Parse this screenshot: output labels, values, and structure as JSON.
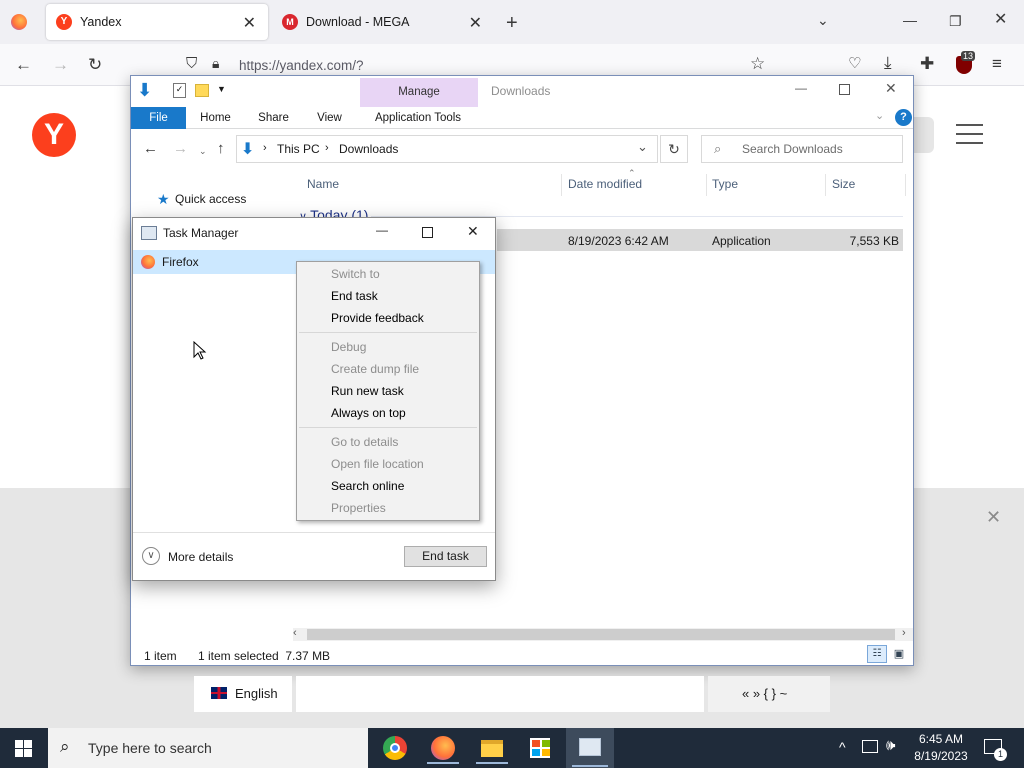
{
  "firefox": {
    "tabs": [
      {
        "title": "Yandex",
        "favicon": "yandex-favicon",
        "active": true
      },
      {
        "title": "Download - MEGA",
        "favicon": "mega-favicon",
        "active": false
      }
    ],
    "url": "https://yandex.com/?",
    "extension_badge": "13"
  },
  "explorer": {
    "title": "Downloads",
    "manage_label": "Manage",
    "ribbon_tabs": [
      "File",
      "Home",
      "Share",
      "View",
      "Application Tools"
    ],
    "breadcrumb": [
      "This PC",
      "Downloads"
    ],
    "search_placeholder": "Search Downloads",
    "sidebar": {
      "quick_access": "Quick access"
    },
    "columns": {
      "name": "Name",
      "date": "Date modified",
      "type": "Type",
      "size": "Size"
    },
    "group_header": "Today (1)",
    "file_row": {
      "date": "8/19/2023 6:42 AM",
      "type": "Application",
      "size": "7,553 KB"
    },
    "status": {
      "items": "1 item",
      "selected": "1 item selected  7.37 MB"
    }
  },
  "task_manager": {
    "title": "Task Manager",
    "process": "Firefox",
    "more_details": "More details",
    "end_task": "End task"
  },
  "context_menu": {
    "switch_to": "Switch to",
    "end_task": "End task",
    "provide_feedback": "Provide feedback",
    "debug": "Debug",
    "create_dump": "Create dump file",
    "run_new_task": "Run new task",
    "always_on_top": "Always on top",
    "go_to_details": "Go to details",
    "open_file_location": "Open file location",
    "search_online": "Search online",
    "properties": "Properties"
  },
  "keyboard": {
    "language": "English",
    "symbols": "« » { } ~"
  },
  "taskbar": {
    "search_placeholder": "Type here to search",
    "time": "6:45 AM",
    "date": "8/19/2023",
    "notifications": "1"
  },
  "colors": {
    "yandex": "#fc3f1d",
    "manage_tab": "#e8d5f5",
    "file_tab": "#1979ca",
    "taskbar": "#1f2b3a"
  }
}
